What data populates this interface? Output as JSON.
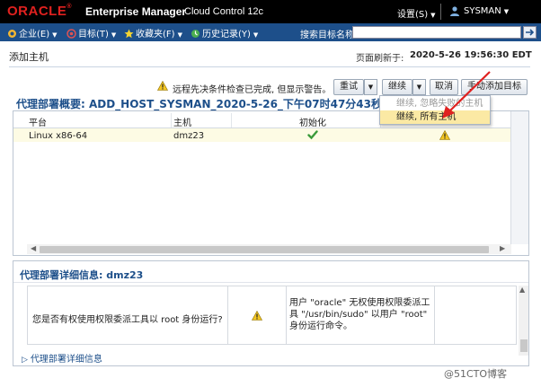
{
  "header": {
    "brand": "ORACLE",
    "product": "Enterprise Manager",
    "edition": "Cloud Control 12c",
    "settings_label": "设置(S)",
    "user_label": "SYSMAN"
  },
  "menubar": {
    "items": [
      {
        "label": "企业(E)",
        "icon": "enterprise-icon"
      },
      {
        "label": "目标(T)",
        "icon": "target-icon"
      },
      {
        "label": "收藏夹(F)",
        "icon": "star-icon"
      },
      {
        "label": "历史记录(Y)",
        "icon": "history-icon"
      }
    ],
    "search_label": "搜索目标名称",
    "search_value": ""
  },
  "page": {
    "title": "添加主机",
    "refresh_label": "页面刷新于:",
    "refresh_time": "2020-5-26 19:56:30 EDT"
  },
  "warning": {
    "message": "远程先决条件检查已完成, 但显示警告。"
  },
  "buttons": {
    "retry": "重试",
    "continue": "继续",
    "cancel": "取消",
    "manual_add": "手动添加目标"
  },
  "dropdown": {
    "items": [
      {
        "label": "继续, 忽略失败的主机",
        "state": "disabled"
      },
      {
        "label": "继续, 所有主机",
        "state": "active"
      }
    ]
  },
  "summary": {
    "title": "代理部署概要: ADD_HOST_SYSMAN_2020-5-26_下午07时47分43秒"
  },
  "table": {
    "columns": [
      "平台",
      "主机",
      "初始化"
    ],
    "rows": [
      {
        "platform": "Linux x86-64",
        "host": "dmz23",
        "init_status": "success",
        "prereq_status": "warning"
      }
    ]
  },
  "details": {
    "title": "代理部署详细信息: dmz23",
    "question": "您是否有权使用权限委派工具以 root 身份运行?",
    "status": "warning",
    "answer": "用户 \"oracle\" 无权使用权限委派工具 \"/usr/bin/sudo\" 以用户 \"root\" 身份运行命令。",
    "section2": "代理部署详细信息"
  },
  "watermark": "@51CTO博客",
  "colors": {
    "accent": "#1d4f8a",
    "brand_red": "#e0211f",
    "warning": "#f3c623",
    "success": "#3a9a3a",
    "highlight": "#fbe9a4"
  }
}
